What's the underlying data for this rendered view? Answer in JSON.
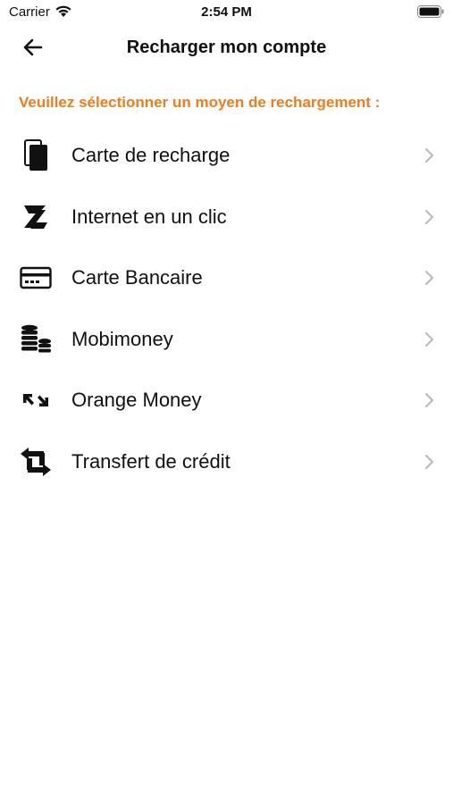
{
  "status_bar": {
    "carrier": "Carrier",
    "time": "2:54 PM"
  },
  "header": {
    "title": "Recharger mon compte"
  },
  "subtitle": "Veuillez sélectionner un moyen de rechargement :",
  "colors": {
    "accent": "#f07c1a",
    "text": "#111111",
    "chevron": "#b8b8bd"
  },
  "items": [
    {
      "label": "Carte de recharge",
      "icon": "phone-card-icon"
    },
    {
      "label": "Internet en un clic",
      "icon": "internet-click-icon"
    },
    {
      "label": "Carte Bancaire",
      "icon": "credit-card-icon"
    },
    {
      "label": "Mobimoney",
      "icon": "coins-icon"
    },
    {
      "label": "Orange Money",
      "icon": "arrows-exchange-icon"
    },
    {
      "label": "Transfert de crédit",
      "icon": "transfer-icon"
    }
  ]
}
